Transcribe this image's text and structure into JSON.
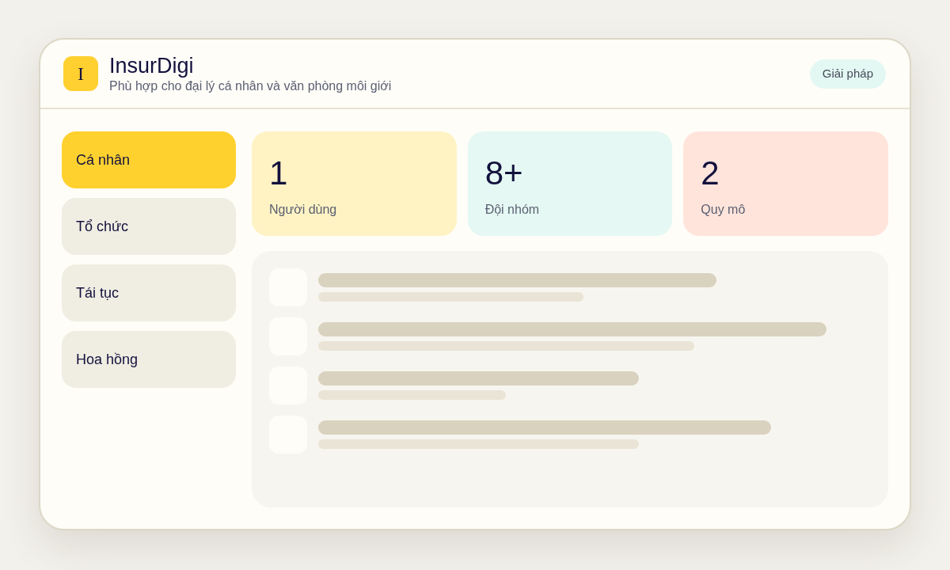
{
  "header": {
    "logo_letter": "I",
    "title": "InsurDigi",
    "subtitle": "Phù hợp cho đại lý cá nhân và văn phòng môi giới",
    "button": "Giải pháp"
  },
  "sidebar": {
    "items": [
      {
        "label": "Cá nhân",
        "selected": true
      },
      {
        "label": "Tổ chức",
        "selected": false
      },
      {
        "label": "Tái tục",
        "selected": false
      },
      {
        "label": "Hoa hồng",
        "selected": false
      }
    ]
  },
  "stats": [
    {
      "value": "1",
      "label": "Người dùng",
      "color": "#fff3c4"
    },
    {
      "value": "8+",
      "label": "Đội nhóm",
      "color": "#e5f8f3"
    },
    {
      "value": "2",
      "label": "Quy mô",
      "color": "#ffe4dc"
    }
  ]
}
